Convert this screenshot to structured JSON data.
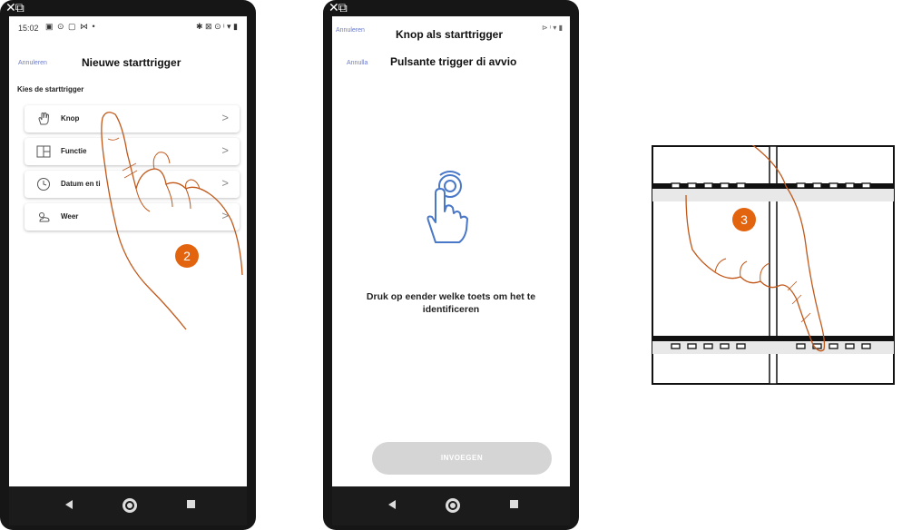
{
  "phone1": {
    "statusbar": {
      "time": "15:02",
      "left_icons": "▣ ⊙ ▢ ⋈ •",
      "right_icons": "✱ ⊠ ⊙ ᵎ ▾ ▮"
    },
    "header": {
      "cancel": "Annuleren",
      "title": "Nieuwe starttrigger"
    },
    "section_label": "Kies de starttrigger",
    "options": [
      {
        "label": "Knop",
        "icon": "hand-icon"
      },
      {
        "label": "Functie",
        "icon": "function-icon"
      },
      {
        "label": "Datum en ti",
        "icon": "clock-icon"
      },
      {
        "label": "Weer",
        "icon": "weather-icon"
      }
    ],
    "step_badge": "2"
  },
  "phone2": {
    "overlay_header": {
      "cancel": "Annuleren",
      "title": "Knop als starttrigger",
      "right_icons": "⊳ ᵎ ▾ ▮"
    },
    "header": {
      "cancel": "Annulla",
      "title": "Pulsante trigger di avvio"
    },
    "instruction": "Druk op eender welke toets om het te identificeren",
    "insert_button": "INVOEGEN"
  },
  "switch": {
    "step_badge": "3"
  },
  "colors": {
    "accent": "#e3640f",
    "link": "#6a7bd0",
    "icon_blue": "#4a78c8",
    "disabled_button": "#d5d5d5"
  }
}
